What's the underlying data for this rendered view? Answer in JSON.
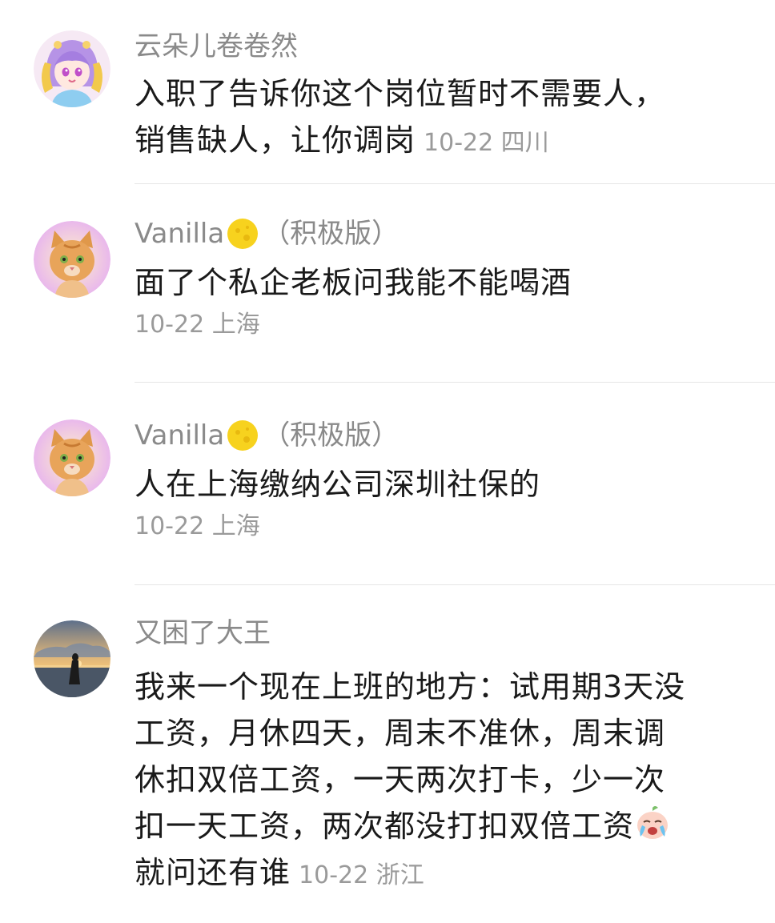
{
  "comments": [
    {
      "username": "云朵儿卷卷然",
      "avatar_icon": "anime-girl-avatar-icon",
      "text_lines": [
        "入职了告诉你这个岗位暂时不需要人，",
        "销售缺人，让你调岗"
      ],
      "date": "10-22",
      "location": "四川"
    },
    {
      "username": "Vanilla",
      "badge_icon": "moon-badge-icon",
      "badge_label": "（积极版）",
      "avatar_icon": "orange-cat-avatar-icon",
      "text_lines": [
        "面了个私企老板问我能不能喝酒"
      ],
      "date": "10-22",
      "location": "上海"
    },
    {
      "username": "Vanilla",
      "badge_icon": "moon-badge-icon",
      "badge_label": "（积极版）",
      "avatar_icon": "orange-cat-avatar-icon",
      "text_lines": [
        "人在上海缴纳公司深圳社保的"
      ],
      "date": "10-22",
      "location": "上海"
    },
    {
      "username": "又困了大王",
      "avatar_icon": "sunset-silhouette-avatar-icon",
      "text_lines": [
        "我来一个现在上班的地方：试用期3天没",
        "工资，月休四天，周末不准休，周末调",
        "休扣双倍工资，一天两次打卡，少一次",
        "扣一天工资，两次都没打扣双倍工资",
        "就问还有谁"
      ],
      "emoji_icon": "crying-face-emoji-icon",
      "date": "10-22",
      "location": "浙江"
    }
  ],
  "colors": {
    "username": "#8a8a8a",
    "text": "#1a1a1a",
    "meta": "#9a9a9a",
    "divider": "#e6e6e6"
  }
}
